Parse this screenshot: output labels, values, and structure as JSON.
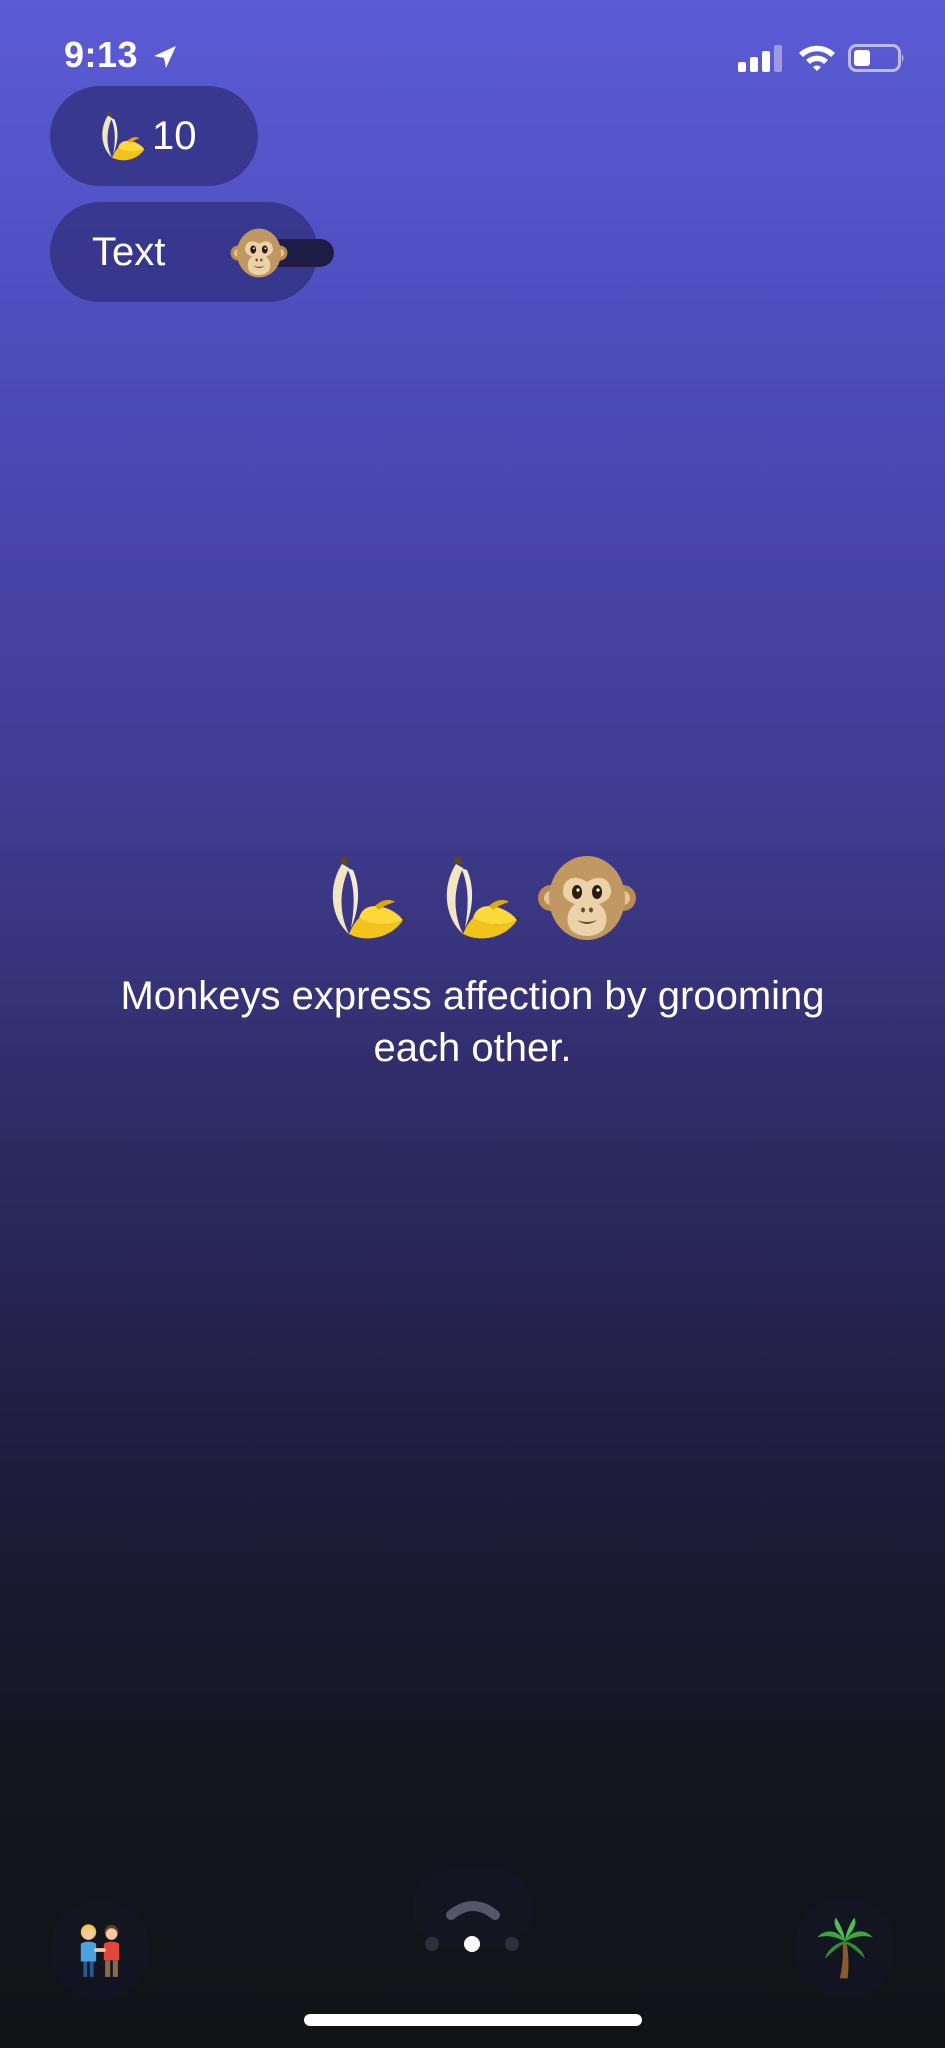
{
  "status_bar": {
    "time": "9:13",
    "icons": [
      "location-arrow-icon",
      "signal-icon",
      "wifi-icon",
      "battery-icon"
    ]
  },
  "banana_counter": {
    "icon": "banana-icon",
    "count": "10"
  },
  "text_toggle": {
    "label": "Text",
    "icon": "monkey-face-icon"
  },
  "main": {
    "emojis": [
      "banana-icon",
      "banana-icon",
      "monkey-face-icon"
    ],
    "fact": "Monkeys express affection by grooming each other."
  },
  "bottom_bar": {
    "left_icon": "couple-icon",
    "center_icon": "chevron-up-icon",
    "right_icon": "palm-tree-icon",
    "pages": 3,
    "active_page": 1
  },
  "colors": {
    "gradient_top": "#5b5bd6",
    "gradient_bottom": "#111316",
    "pill": "#2e2e78",
    "text": "#ffffff"
  }
}
